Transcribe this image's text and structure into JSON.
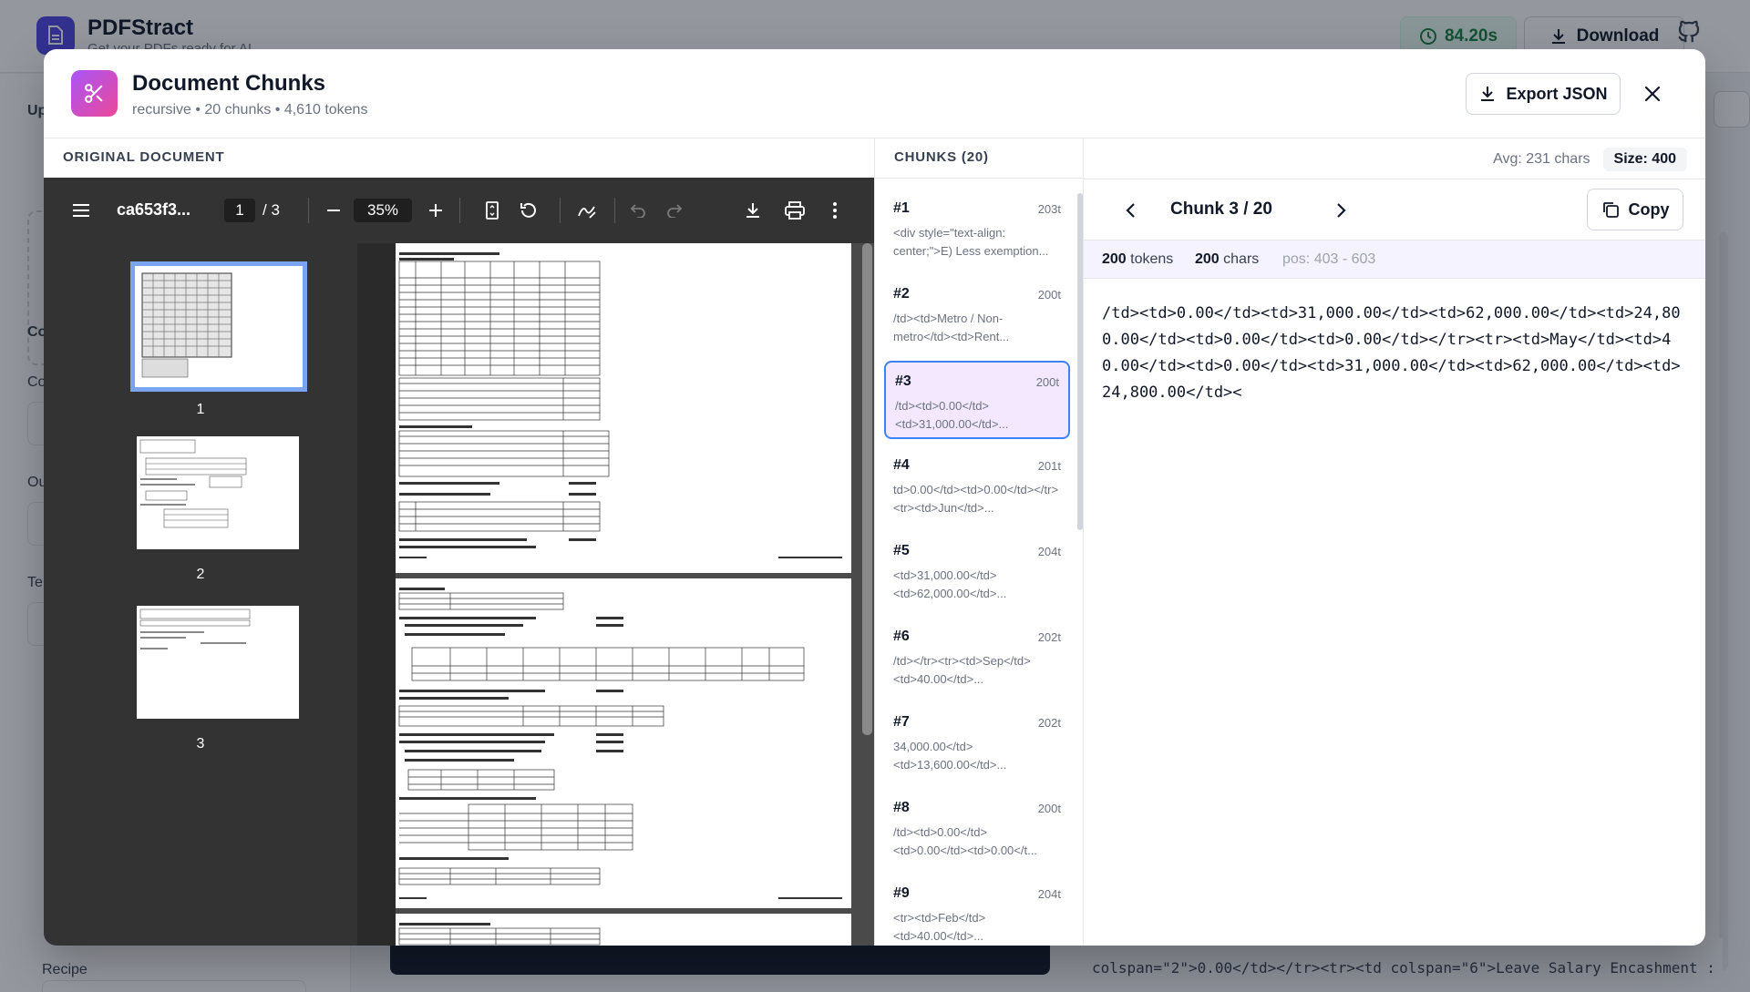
{
  "app": {
    "name": "PDFStract",
    "tagline": "Get your PDFs ready for AI",
    "timer": "84.20s",
    "download_label": "Download",
    "sidebar_labels": [
      "Up",
      "Co",
      "Co",
      "Ou",
      "Te",
      "Recipe"
    ],
    "bg_code_lines": [
      "colspan=\"2\">0.00</td></tr><tr><td colspan=\"6\">Leave Salary Encashment :"
    ]
  },
  "modal": {
    "title": "Document Chunks",
    "subtitle": "recursive • 20 chunks • 4,610 tokens",
    "export_label": "Export JSON"
  },
  "viewer": {
    "section_label": "ORIGINAL DOCUMENT",
    "file_name": "ca653f3...",
    "current_page": "1",
    "total_pages": "/ 3",
    "zoom": "35%",
    "thumbnails": [
      "1",
      "2",
      "3"
    ]
  },
  "chunks_panel": {
    "label": "CHUNKS (20)",
    "avg": "Avg: 231 chars",
    "size": "Size: 400",
    "items": [
      {
        "id": "#1",
        "tokens": "203t",
        "preview": "<div style=\"text-align: center;\">E) Less exemption..."
      },
      {
        "id": "#2",
        "tokens": "200t",
        "preview": "/td><td>Metro / Non-metro</td><td>Rent..."
      },
      {
        "id": "#3",
        "tokens": "200t",
        "preview": "/td><td>0.00</td><td>31,000.00</td>..."
      },
      {
        "id": "#4",
        "tokens": "201t",
        "preview": "td>0.00</td><td>0.00</td></tr><tr><td>Jun</td>..."
      },
      {
        "id": "#5",
        "tokens": "204t",
        "preview": "<td>31,000.00</td><td>62,000.00</td>..."
      },
      {
        "id": "#6",
        "tokens": "202t",
        "preview": "/td></tr><tr><td>Sep</td><td>40.00</td>..."
      },
      {
        "id": "#7",
        "tokens": "202t",
        "preview": "34,000.00</td><td>13,600.00</td>..."
      },
      {
        "id": "#8",
        "tokens": "200t",
        "preview": "/td><td>0.00</td><td>0.00</td><td>0.00</t..."
      },
      {
        "id": "#9",
        "tokens": "204t",
        "preview": "<tr><td>Feb</td><td>40.00</td>..."
      }
    ]
  },
  "detail": {
    "title": "Chunk 3 / 20",
    "copy_label": "Copy",
    "tokens": "200",
    "tokens_label": "tokens",
    "chars": "200",
    "chars_label": "chars",
    "pos": "pos: 403 - 603",
    "content": "/td><td>0.00</td><td>31,000.00</td><td>62,000.00</td><td>24,800.00</td><td>0.00</td><td>0.00</td></tr><tr><td>May</td><td>40.00</td><td>0.00</td><td>31,000.00</td><td>62,000.00</td><td>24,800.00</td><"
  }
}
